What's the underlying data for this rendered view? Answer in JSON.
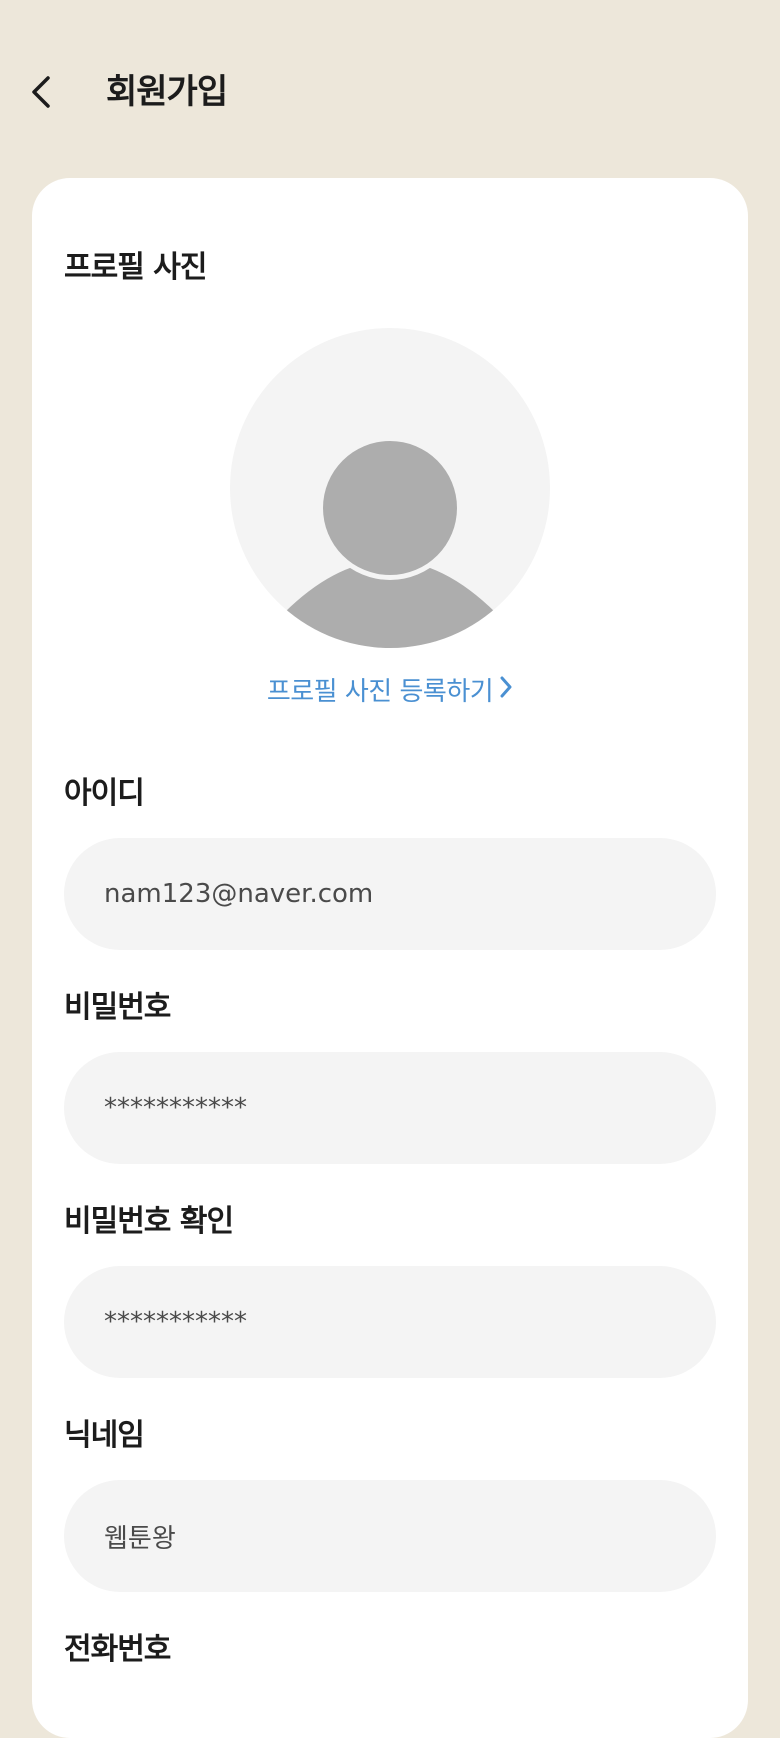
{
  "header": {
    "title": "회원가입",
    "back_icon": "chevron-left-icon"
  },
  "profile": {
    "section_title": "프로필 사진",
    "avatar_icon": "user-placeholder-icon",
    "register_link": "프로필 사진 등록하기",
    "link_icon": "chevron-right-icon"
  },
  "form": {
    "id_label": "아이디",
    "id_value": "nam123@naver.com",
    "password_label": "비밀번호",
    "password_value": "***********",
    "password_confirm_label": "비밀번호 확인",
    "password_confirm_value": "***********",
    "nickname_label": "닉네임",
    "nickname_value": "웹툰왕",
    "phone_label": "전화번호"
  },
  "colors": {
    "background": "#ede7da",
    "card": "#ffffff",
    "field": "#f4f4f4",
    "accent_link": "#4a90d2",
    "avatar_silhouette": "#adadad"
  }
}
